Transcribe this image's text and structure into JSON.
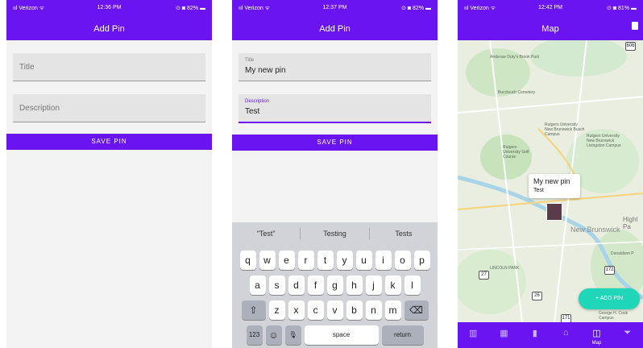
{
  "phone1": {
    "status": {
      "carrier": "ııl Verizon ᯤ",
      "time": "12:36 PM",
      "battery": "⊙ ◙ 82% ▬"
    },
    "title": "Add Pin",
    "title_placeholder": "Title",
    "description_placeholder": "Description",
    "save_label": "SAVE PIN"
  },
  "phone2": {
    "status": {
      "carrier": "ııl Verizon ᯤ",
      "time": "12:37 PM",
      "battery": "⊙ ◙ 82% ▬"
    },
    "title": "Add Pin",
    "title_label": "Title",
    "title_value": "My new pin",
    "description_label": "Description",
    "description_value": "Test",
    "save_label": "SAVE PIN",
    "suggestions": [
      "\"Test\"",
      "Testing",
      "Tests"
    ],
    "row1": [
      "q",
      "w",
      "e",
      "r",
      "t",
      "y",
      "u",
      "i",
      "o",
      "p"
    ],
    "row2": [
      "a",
      "s",
      "d",
      "f",
      "g",
      "h",
      "j",
      "k",
      "l"
    ],
    "row3": [
      "z",
      "x",
      "c",
      "v",
      "b",
      "n",
      "m"
    ],
    "shift": "⇧",
    "backspace": "⌫",
    "num_key": "123",
    "emoji_key": "☺",
    "mic_key": "🎙",
    "space_key": "space",
    "return_key": "return"
  },
  "phone3": {
    "status": {
      "carrier": "ııl Verizon ᯤ",
      "time": "12:42 PM",
      "battery": "⊙ ◙ 81% ▬"
    },
    "title": "Map",
    "map_labels": {
      "park1": "Ambrose Doty's Brook Park",
      "cemetery": "Buccleuch Cemetery",
      "rutgers1": "Rutgers University New Brunswick Busch Campus",
      "rutgers2": "Rutgers University New Brunswick Livingston Campus",
      "golf": "Rutgers University Golf Course",
      "area": "New Brunswick",
      "highland": "Highl Pa",
      "lincoln": "LINCOLN PARK",
      "donaldson": "Donaldson P",
      "cook": "George H. Cook Campus",
      "route27": "27",
      "route26": "26",
      "route171": "171",
      "route172": "172",
      "route606": "606"
    },
    "pin_title": "My new pin",
    "pin_description": "Test",
    "fab_label": "ADD PIN",
    "tabs": [
      {
        "icon": "▥",
        "label": ""
      },
      {
        "icon": "▦",
        "label": ""
      },
      {
        "icon": "▮",
        "label": ""
      },
      {
        "icon": "⌂",
        "label": ""
      },
      {
        "icon": "◫",
        "label": "Map"
      },
      {
        "icon": "⏷",
        "label": ""
      }
    ]
  },
  "colors": {
    "primary": "#6a14f2",
    "accent": "#1fd6b8",
    "background": "#f3f3f3"
  }
}
